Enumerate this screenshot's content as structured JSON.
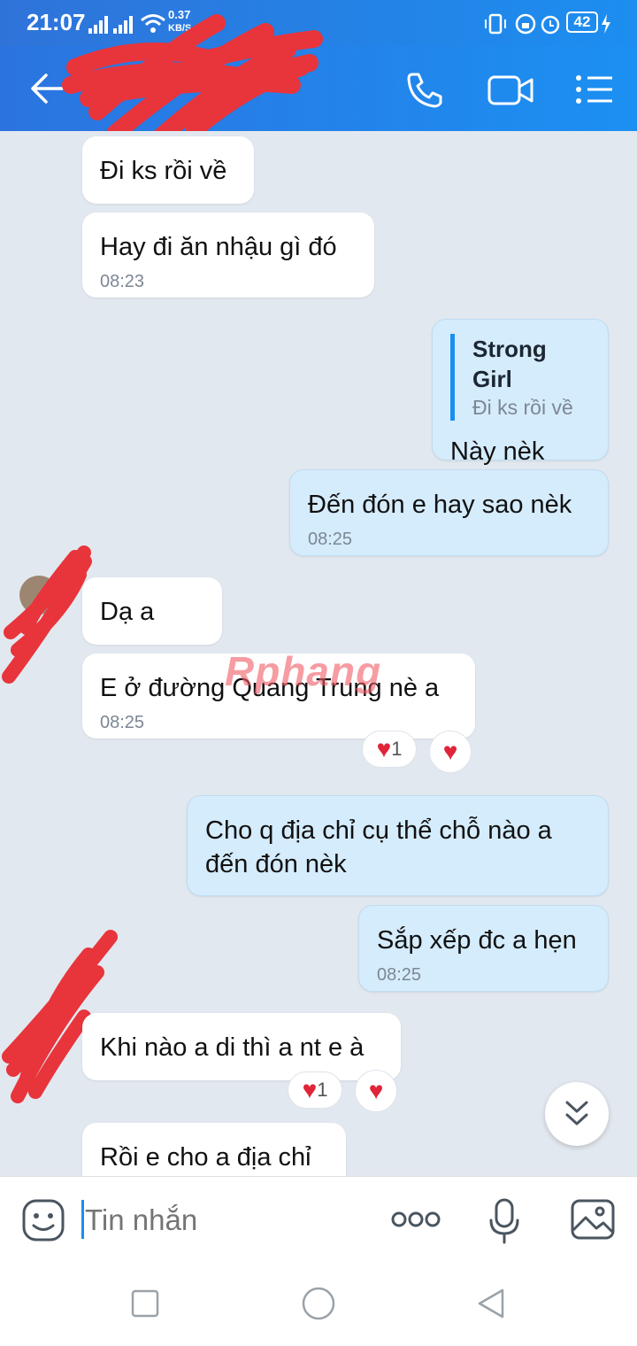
{
  "status_bar": {
    "time": "21:07",
    "net_speed_value": "0.37",
    "net_speed_unit": "KB/S",
    "battery": "42"
  },
  "header": {
    "back_icon": "arrow-left-icon",
    "call_icon": "phone-icon",
    "video_icon": "video-camera-icon",
    "menu_icon": "list-menu-icon"
  },
  "messages": {
    "m1": {
      "text": "Đi ks rồi về"
    },
    "m2": {
      "text": "Hay đi ăn nhậu gì đó",
      "time": "08:23"
    },
    "m3": {
      "quote_author": "Strong Girl",
      "quote_text": "Đi ks rồi về",
      "text": "Này nèk"
    },
    "m4": {
      "text": "Đến đón e hay sao nèk",
      "time": "08:25"
    },
    "m5": {
      "text": "Dạ a"
    },
    "m6": {
      "text": "E ở đường Quang Trung nè a",
      "time": "08:25",
      "reaction_count": "1"
    },
    "m7": {
      "text": "Cho q địa chỉ cụ thể chỗ nào a đến đón nèk"
    },
    "m8": {
      "text": "Sắp xếp đc a hẹn",
      "time": "08:25"
    },
    "m9": {
      "text": "Khi nào a di thì a nt e à",
      "reaction_count": "1"
    },
    "m10": {
      "text": "Rồi e cho a địa chỉ"
    }
  },
  "watermark": "Rphang",
  "composer": {
    "placeholder": "Tin nhắn",
    "emoji_icon": "sticker-face-icon",
    "more_icon": "more-dots-icon",
    "mic_icon": "microphone-icon",
    "image_icon": "image-icon"
  },
  "nav": {
    "recent_icon": "square-icon",
    "home_icon": "circle-icon",
    "back_icon": "triangle-back-icon"
  },
  "colors": {
    "header": "#1c8ef0",
    "outgoing_bubble": "#d5ecfc",
    "incoming_bubble": "#ffffff",
    "reaction_heart": "#e0243a"
  }
}
